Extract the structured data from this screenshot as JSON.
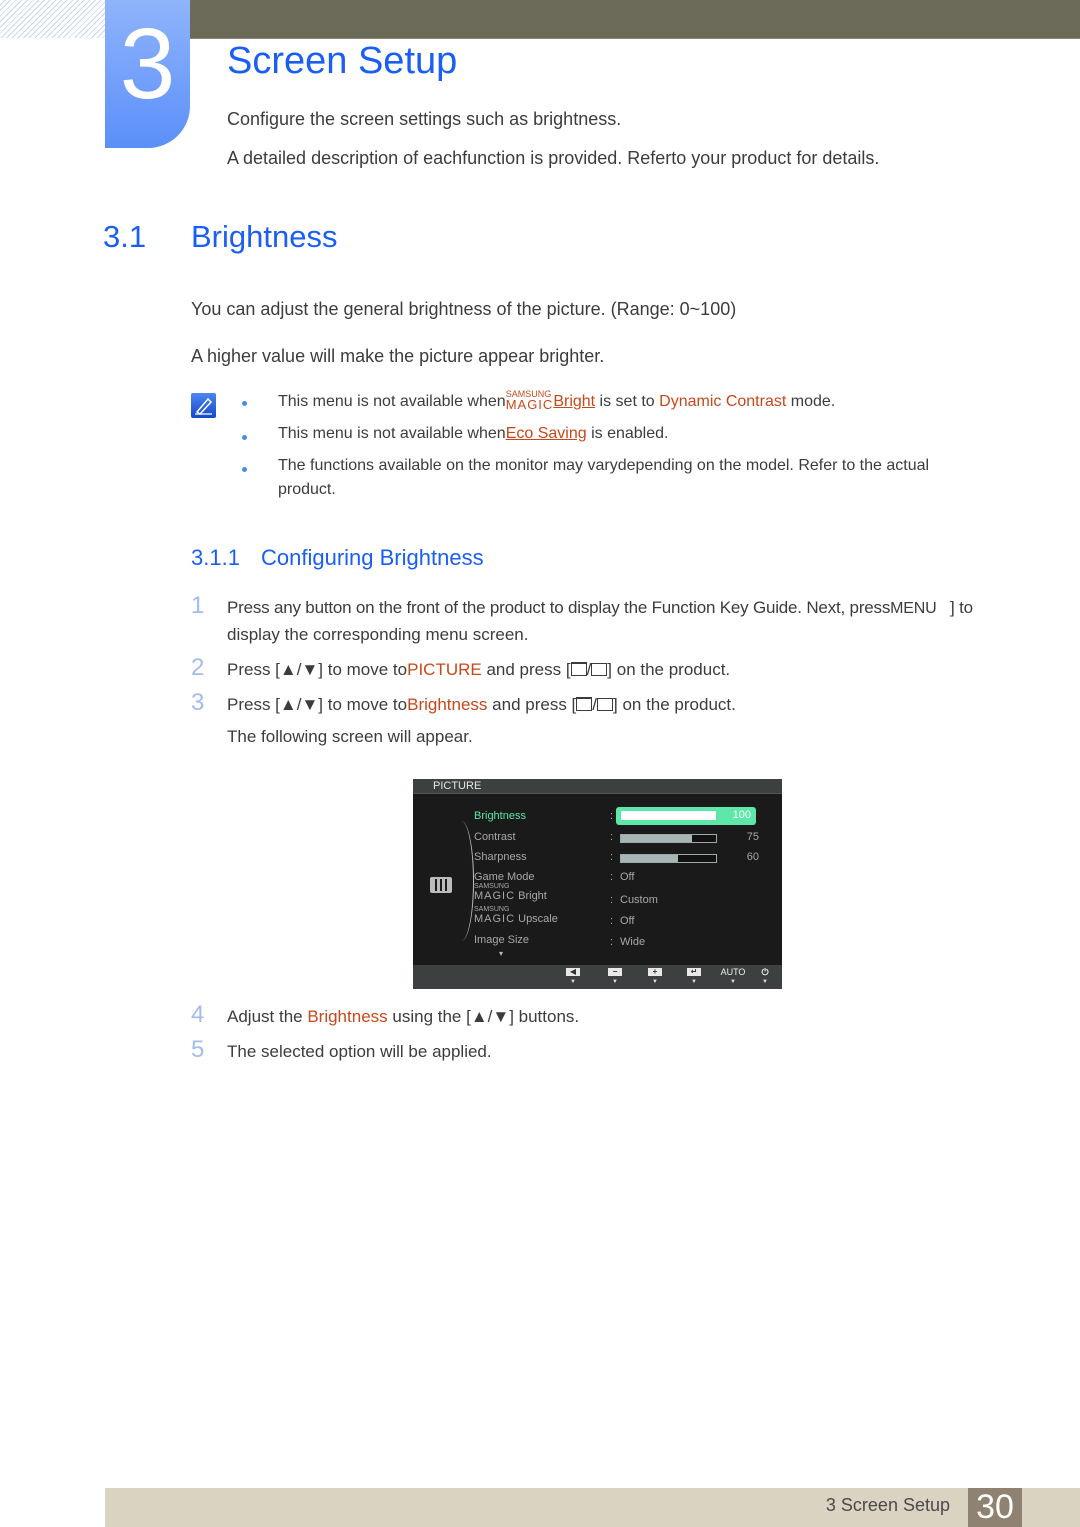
{
  "chapter": {
    "number": "3",
    "title": "Screen Setup",
    "intro": [
      "Configure the screen settings such as brightness.",
      "A detailed description of eachfunction is provided. Referto your product for details."
    ]
  },
  "section": {
    "number": "3.1",
    "title": "Brightness",
    "paragraphs": [
      "You can adjust the general brightness of the picture. (Range: 0~100)",
      "A higher value will make the picture appear brighter."
    ]
  },
  "notes": {
    "icon": "note-pencil-icon",
    "items": [
      {
        "before": "This menu is not available when",
        "magic_top": "SAMSUNG",
        "magic_bottom": "MAGIC",
        "link": "Bright",
        "middle": " is set to ",
        "highlight": "Dynamic Contrast",
        "after": " mode."
      },
      {
        "before": "This menu is not available when",
        "link": "Eco Saving",
        "after": " is enabled."
      },
      {
        "line1": "The functions available on the monitor may varydepending on the model. Refer to the actual",
        "line2": "product."
      }
    ]
  },
  "subsection": {
    "number": "3.1.1",
    "title": "Configuring Brightness"
  },
  "steps": [
    {
      "num": "1",
      "line1_before": "Press any button on the front of the product to display the Function Key Guide. Next, press",
      "key": "MENU",
      "line1_after": "] to",
      "line2": "display the corresponding menu screen."
    },
    {
      "num": "2",
      "before": "Press [",
      "arrows": "▲/▼",
      "mid1": "] to move to",
      "highlight": "PICTURE",
      "mid2": " and press [",
      "mid3": "] on the product."
    },
    {
      "num": "3",
      "before": "Press [",
      "arrows": "▲/▼",
      "mid1": "] to move to",
      "highlight": "Brightness",
      "mid2": " and press [",
      "mid3": "] on the product.",
      "sub": "The following screen will appear."
    },
    {
      "num": "4",
      "before": "Adjust the ",
      "highlight": "Brightness",
      "mid1": " using the [",
      "arrows": "▲/▼",
      "after": "] buttons."
    },
    {
      "num": "5",
      "text": "The selected option will be applied."
    }
  ],
  "osd": {
    "header": "PICTURE",
    "rows": [
      {
        "label": "Brightness",
        "value_pct": 100,
        "num": "100",
        "selected": true
      },
      {
        "label": "Contrast",
        "value_pct": 75,
        "num": "75"
      },
      {
        "label": "Sharpness",
        "value_pct": 60,
        "num": "60"
      },
      {
        "label": "Game Mode",
        "value": "Off"
      },
      {
        "magic_top": "SAMSUNG",
        "magic_bottom": "MAGIC",
        "label": "Bright",
        "value": "Custom"
      },
      {
        "magic_top": "SAMSUNG",
        "magic_bottom": "MAGIC",
        "label": "Upscale",
        "value": "Off"
      },
      {
        "label": "Image Size",
        "value": "Wide"
      }
    ],
    "colon": ":",
    "more": "▾",
    "buttons": [
      {
        "icon": "left-arrow-icon",
        "glyph": "◀"
      },
      {
        "icon": "minus-icon",
        "glyph": "−"
      },
      {
        "icon": "plus-icon",
        "glyph": "+"
      },
      {
        "icon": "enter-icon",
        "glyph": "↵"
      },
      {
        "icon": "auto-label",
        "label": "AUTO"
      },
      {
        "icon": "power-icon",
        "glyph": "⏻"
      }
    ],
    "button_marker": "▼",
    "colors": {
      "selected": "#5de7a8",
      "selected_text": "#5de7a8"
    }
  },
  "footer": {
    "text": "3 Screen Setup",
    "page": "30"
  }
}
